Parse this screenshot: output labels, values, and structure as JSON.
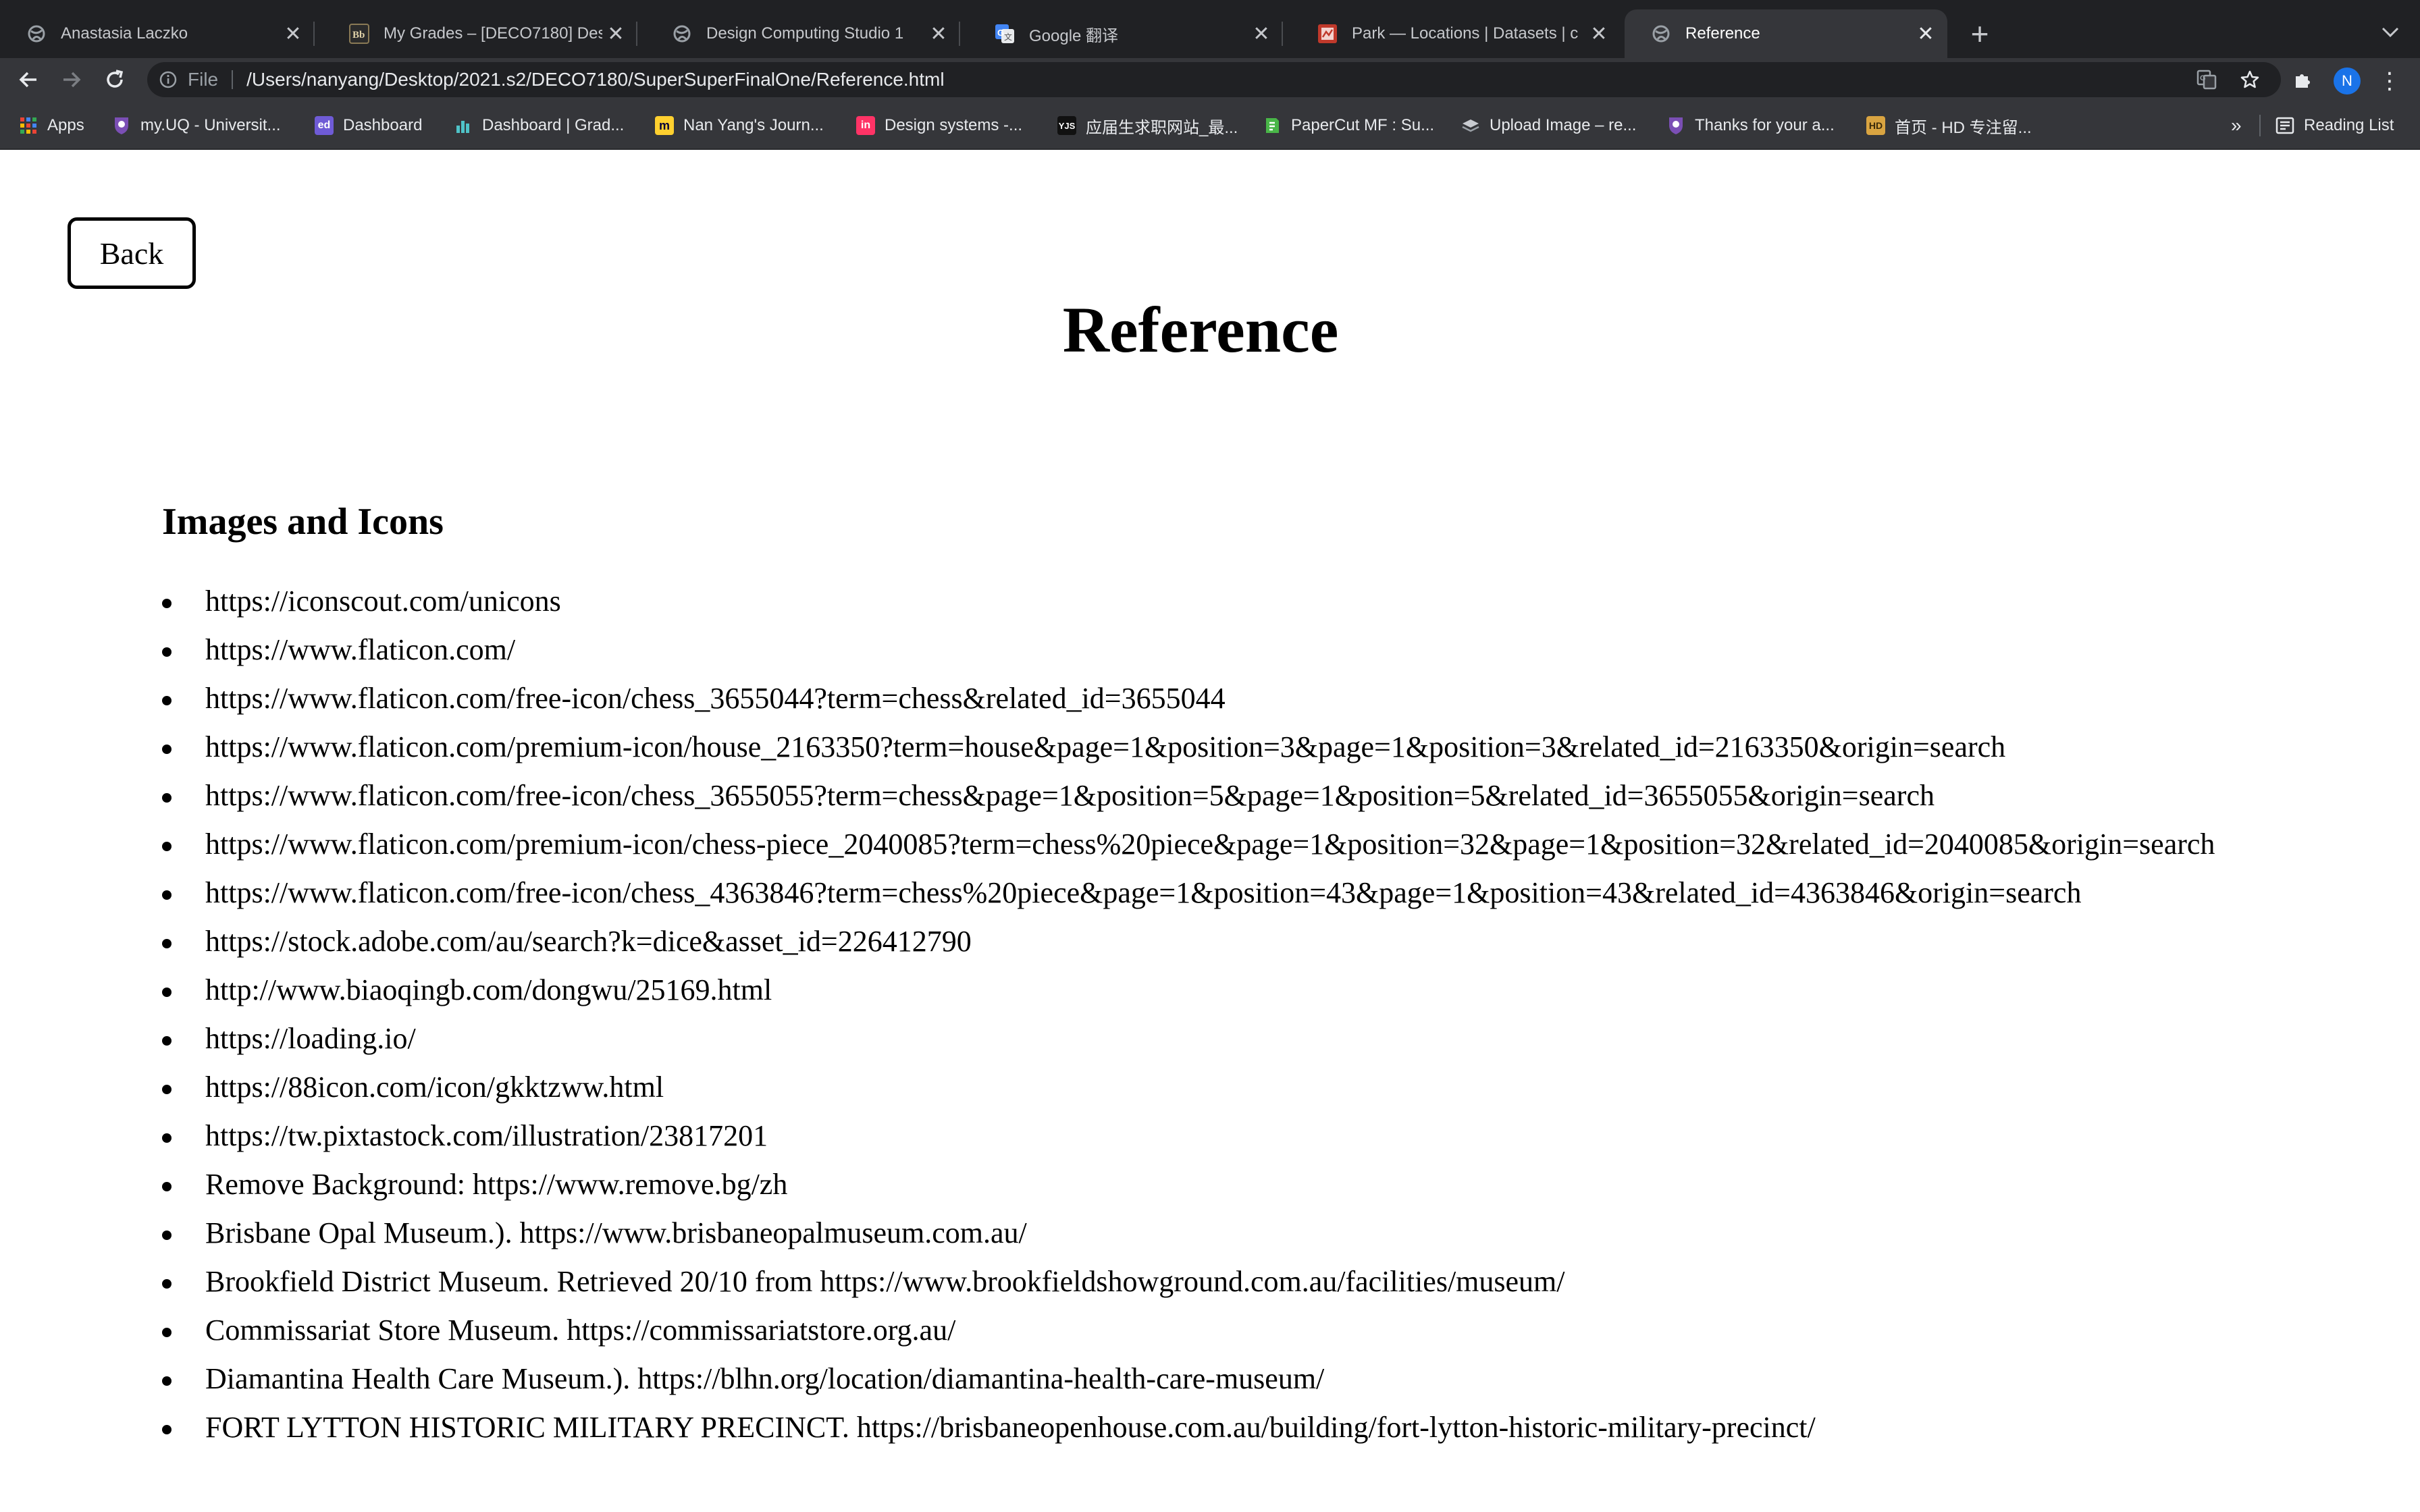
{
  "browser": {
    "tabs": [
      {
        "title": "Anastasia Laczko",
        "icon": "globe-icon",
        "active": false
      },
      {
        "title": "My Grades – [DECO7180] Desi",
        "icon": "bb-icon",
        "active": false
      },
      {
        "title": "Design Computing Studio 1",
        "icon": "globe-icon",
        "active": false
      },
      {
        "title": "Google 翻译",
        "icon": "google-translate-icon",
        "active": false
      },
      {
        "title": "Park — Locations | Datasets | c",
        "icon": "dataset-icon",
        "active": false
      },
      {
        "title": "Reference",
        "icon": "globe-icon",
        "active": true
      }
    ],
    "address_bar": {
      "scheme": "File",
      "url": "/Users/nanyang/Desktop/2021.s2/DECO7180/SuperSuperFinalOne/Reference.html"
    },
    "profile_initial": "N",
    "bookmarks": [
      {
        "label": "Apps",
        "icon": "apps-grid-icon"
      },
      {
        "label": "my.UQ - Universit...",
        "icon": "uq-shield-icon"
      },
      {
        "label": "Dashboard",
        "icon": "ed-icon"
      },
      {
        "label": "Dashboard | Grad...",
        "icon": "bars-chart-icon"
      },
      {
        "label": "Nan Yang's Journ...",
        "icon": "miro-icon"
      },
      {
        "label": "Design systems -...",
        "icon": "invision-icon"
      },
      {
        "label": "应届生求职网站_最...",
        "icon": "yingjiesheng-icon"
      },
      {
        "label": "PaperCut MF : Su...",
        "icon": "papercut-icon"
      },
      {
        "label": "Upload Image – re...",
        "icon": "layers-icon"
      },
      {
        "label": "Thanks for your a...",
        "icon": "uq-shield-icon"
      },
      {
        "label": "首页 - HD 专注留...",
        "icon": "hd-icon"
      }
    ],
    "bookmarks_more": "»",
    "reading_list": "Reading List"
  },
  "page": {
    "back_label": "Back",
    "title": "Reference",
    "section_heading": "Images and Icons",
    "references": [
      "https://iconscout.com/unicons",
      "https://www.flaticon.com/",
      "https://www.flaticon.com/free-icon/chess_3655044?term=chess&related_id=3655044",
      "https://www.flaticon.com/premium-icon/house_2163350?term=house&page=1&position=3&page=1&position=3&related_id=2163350&origin=search",
      "https://www.flaticon.com/free-icon/chess_3655055?term=chess&page=1&position=5&page=1&position=5&related_id=3655055&origin=search",
      "https://www.flaticon.com/premium-icon/chess-piece_2040085?term=chess%20piece&page=1&position=32&page=1&position=32&related_id=2040085&origin=search",
      "https://www.flaticon.com/free-icon/chess_4363846?term=chess%20piece&page=1&position=43&page=1&position=43&related_id=4363846&origin=search",
      "https://stock.adobe.com/au/search?k=dice&asset_id=226412790",
      "http://www.biaoqingb.com/dongwu/25169.html",
      "https://loading.io/",
      "https://88icon.com/icon/gkktzww.html",
      "https://tw.pixtastock.com/illustration/23817201",
      "Remove Background: https://www.remove.bg/zh",
      "Brisbane Opal Museum.). https://www.brisbaneopalmuseum.com.au/",
      "Brookfield District Museum. Retrieved 20/10 from https://www.brookfieldshowground.com.au/facilities/museum/",
      "Commissariat Store Museum. https://commissariatstore.org.au/",
      "Diamantina Health Care Museum.). https://blhn.org/location/diamantina-health-care-museum/",
      "FORT LYTTON HISTORIC MILITARY PRECINCT. https://brisbaneopenhouse.com.au/building/fort-lytton-historic-military-precinct/"
    ]
  }
}
